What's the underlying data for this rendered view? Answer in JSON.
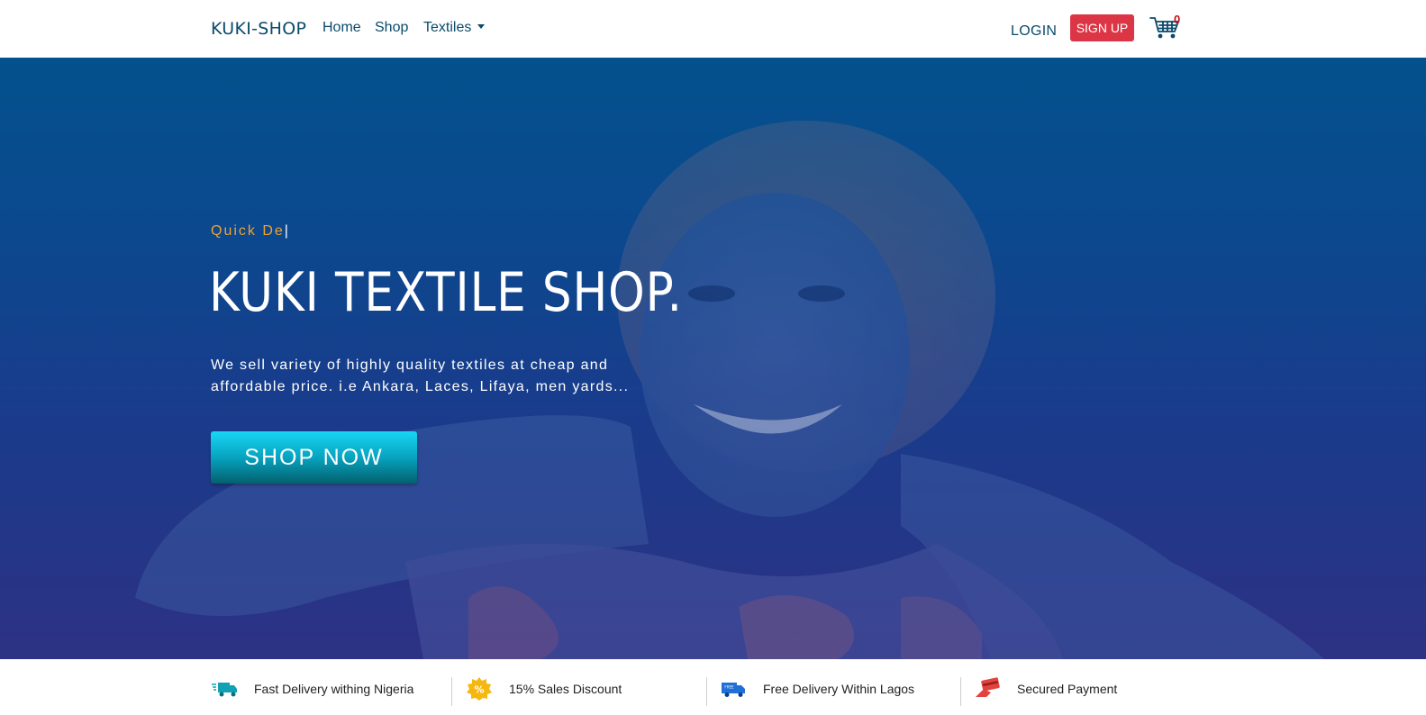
{
  "nav": {
    "brand": "KUKI-SHOP",
    "home": "Home",
    "shop": "Shop",
    "textiles": "Textiles",
    "login": "LOGIN",
    "signup": "SIGN UP",
    "cart_count": "0",
    "cart_icon": "cart-icon",
    "colors": {
      "brand_text": "#0b4a6b",
      "signup_bg": "#dc3545",
      "cart_badge": "#c41018"
    }
  },
  "hero": {
    "typed_text": "Quick De",
    "typed_cursor": "|",
    "title": "KUKI TEXTILE SHOP.",
    "description": "We sell variety of highly quality textiles at cheap and affordable price. i.e Ankara, Laces, Lifaya, men yards...",
    "cta": "SHOP NOW",
    "colors": {
      "accent": "#f2a22d",
      "gradient_top": "#04558e",
      "gradient_bottom": "#2e3384",
      "cta": "#07a3c0"
    }
  },
  "features": [
    {
      "icon": "delivery-truck-icon",
      "label": "Fast Delivery withing Nigeria"
    },
    {
      "icon": "discount-badge-icon",
      "label": "15% Sales Discount"
    },
    {
      "icon": "free-delivery-van-icon",
      "label": "Free Delivery Within Lagos"
    },
    {
      "icon": "secure-payment-card-icon",
      "label": "Secured Payment"
    }
  ],
  "feature_badges": {
    "discount_symbol": "%",
    "free_tag": "FREE"
  }
}
